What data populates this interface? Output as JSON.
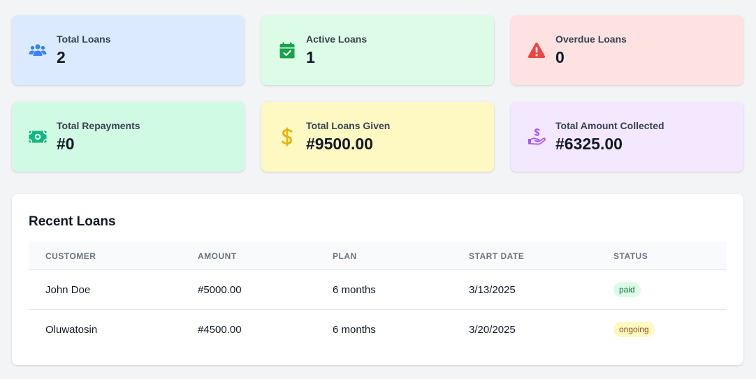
{
  "stats": [
    {
      "label": "Total Loans",
      "value": "2",
      "icon": "users-icon",
      "color": "#3b82f6",
      "bg": "#dbeafe"
    },
    {
      "label": "Active Loans",
      "value": "1",
      "icon": "calendar-check-icon",
      "color": "#16a34a",
      "bg": "#dcfce7"
    },
    {
      "label": "Overdue Loans",
      "value": "0",
      "icon": "warning-icon",
      "color": "#ef4444",
      "bg": "#fee2e2"
    },
    {
      "label": "Total Repayments",
      "value": "#0",
      "icon": "money-bill-icon",
      "color": "#10b981",
      "bg": "#d1fae5"
    },
    {
      "label": "Total Loans Given",
      "value": "#9500.00",
      "icon": "dollar-icon",
      "color": "#eab308",
      "bg": "#fef9c3"
    },
    {
      "label": "Total Amount Collected",
      "value": "#6325.00",
      "icon": "hand-holding-dollar-icon",
      "color": "#a855f7",
      "bg": "#f3e8ff"
    }
  ],
  "recent": {
    "title": "Recent Loans",
    "columns": [
      "CUSTOMER",
      "AMOUNT",
      "PLAN",
      "START DATE",
      "STATUS"
    ],
    "rows": [
      {
        "customer": "John Doe",
        "amount": "#5000.00",
        "plan": "6 months",
        "start_date": "3/13/2025",
        "status": "paid"
      },
      {
        "customer": "Oluwatosin",
        "amount": "#4500.00",
        "plan": "6 months",
        "start_date": "3/20/2025",
        "status": "ongoing"
      }
    ]
  }
}
